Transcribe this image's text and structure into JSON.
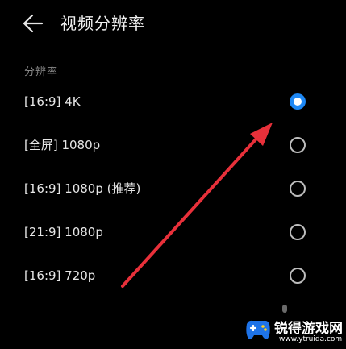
{
  "header": {
    "back_icon": "arrow-left-icon",
    "title": "视频分辨率"
  },
  "section": {
    "label": "分辨率"
  },
  "options": [
    {
      "label": "[16:9] 4K",
      "selected": true
    },
    {
      "label": "[全屏] 1080p",
      "selected": false
    },
    {
      "label": "[16:9] 1080p (推荐)",
      "selected": false
    },
    {
      "label": "[21:9] 1080p",
      "selected": false
    },
    {
      "label": "[16:9] 720p",
      "selected": false
    }
  ],
  "colors": {
    "background": "#000000",
    "accent": "#1e88f5",
    "annotation_arrow": "#e8303a"
  },
  "watermark": {
    "title": "锐得游戏网",
    "url": "www.ytruida.com",
    "icon": "gamepad-logo-icon"
  }
}
